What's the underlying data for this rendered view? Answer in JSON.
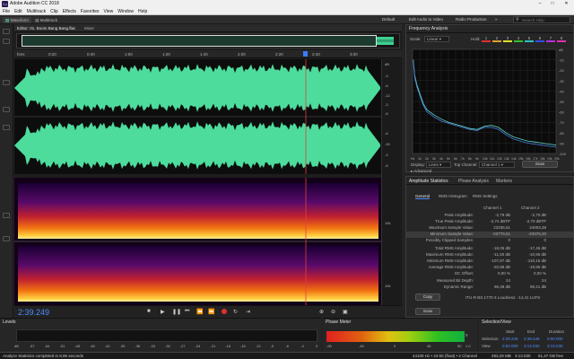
{
  "titlebar": {
    "title": "Adobe Audition CC 2018"
  },
  "menu": [
    "File",
    "Edit",
    "Multitrack",
    "Clip",
    "Effects",
    "Favorites",
    "View",
    "Window",
    "Help"
  ],
  "toolbar": {
    "waveform": "Waveform",
    "multitrack": "Multitrack",
    "ws_default": "Default",
    "ws_edit_video": "Edit Audio to Video",
    "ws_radio": "Radio Production",
    "search_placeholder": "Search Help"
  },
  "editor": {
    "tab_file": "Editor: 01. Boom Bang Bang.flac",
    "tab_mixer": "Mixer",
    "ruler_unit": "hms",
    "ruler_ticks": [
      "0:20",
      "0:40",
      "1:00",
      "1:20",
      "1:40",
      "2:00",
      "2:20",
      "2:40",
      "3:00"
    ],
    "db_labels_ch1": [
      "dB",
      "-3",
      "-6",
      "-12",
      "-3",
      "-6"
    ],
    "db_labels_ch2": [
      "-6",
      "-15",
      "-3",
      "-6"
    ],
    "hz_labels": [
      "10k",
      "10k"
    ],
    "timecode": "2:39.249"
  },
  "freq": {
    "title": "Frequency Analysis",
    "scale_label": "Scale:",
    "scale_value": "Linear",
    "hold_label": "Hold:",
    "hold_buttons": [
      "1",
      "2",
      "3",
      "4",
      "5",
      "6",
      "7",
      "8"
    ],
    "hold_colors": [
      "#e03030",
      "#e0a030",
      "#e0e030",
      "#30c030",
      "#30c0c0",
      "#3050e0",
      "#b030e0",
      "#e030b0"
    ],
    "db_ticks": [
      "dB",
      "-10",
      "-20",
      "-30",
      "-40",
      "-50",
      "-60",
      "-70",
      "-80",
      "-90",
      "-100"
    ],
    "hz_ticks": [
      "Hz",
      "1k",
      "2k",
      "3k",
      "4k",
      "5k",
      "6k",
      "7k",
      "8k",
      "9k",
      "10k",
      "11k",
      "12k",
      "13k",
      "14k",
      "15k",
      "16k",
      "17k",
      "18k",
      "19k",
      "20k"
    ],
    "display_label": "Display:",
    "display_value": "Lines",
    "top_channel_label": "Top Channel:",
    "top_channel_value": "Channel 1",
    "scan_label": "Scan",
    "advanced_label": "Advanced"
  },
  "amp": {
    "tabs": [
      "Amplitude Statistics",
      "Phase Analysis",
      "Markers"
    ],
    "subtabs": [
      "General",
      "RMS Histogram",
      "RMS Settings"
    ],
    "ch1_header": "Channel 1",
    "ch2_header": "Channel 2",
    "rows": [
      {
        "label": "Peak Amplitude:",
        "c1": "-2,79 dB",
        "c2": "-2,70 dB"
      },
      {
        "label": "True Peak Amplitude:",
        "c1": "-2,74 dBTP",
        "c2": "-2,70 dBTP"
      },
      {
        "label": "Maximum Sample Value:",
        "c1": "23336,61",
        "c2": "24003,38"
      },
      {
        "label": "Minimum Sample Value:",
        "c1": "-23779,61",
        "c2": "-23375,20"
      },
      {
        "label": "Possibly Clipped Samples:",
        "c1": "0",
        "c2": "0"
      },
      {
        "label": "Total RMS Amplitude:",
        "c1": "-18,06 dB",
        "c2": "-17,46 dB"
      },
      {
        "label": "Maximum RMS Amplitude:",
        "c1": "-11,50 dB",
        "c2": "-10,95 dB"
      },
      {
        "label": "Minimum RMS Amplitude:",
        "c1": "-107,87 dB",
        "c2": "-110,16 dB"
      },
      {
        "label": "Average RMS Amplitude:",
        "c1": "-20,98 dB",
        "c2": "-19,95 dB"
      },
      {
        "label": "DC Offset:",
        "c1": "0,00 %",
        "c2": "0,00 %"
      },
      {
        "label": "Measured Bit Depth:",
        "c1": "24",
        "c2": "24"
      },
      {
        "label": "Dynamic Range:",
        "c1": "96,38 dB",
        "c2": "99,21 dB"
      }
    ],
    "loudness": "ITU-R BS.1770-3 Loudness: -14,41 LUFS",
    "copy_label": "Copy",
    "scan_label": "Scan"
  },
  "levels": {
    "title": "Levels",
    "ticks": [
      "dB",
      "-57",
      "-54",
      "-51",
      "-48",
      "-45",
      "-42",
      "-39",
      "-36",
      "-33",
      "-30",
      "-27",
      "-24",
      "-21",
      "-18",
      "-15",
      "-12",
      "-9",
      "-6",
      "-3",
      "0"
    ]
  },
  "phase": {
    "title": "Phase Meter",
    "ticks": [
      "-90",
      "-45",
      "0",
      "45",
      "90"
    ],
    "left_value": "0",
    "right_value": "1.0"
  },
  "selview": {
    "title": "Selection/View",
    "col_start": "Start",
    "col_end": "End",
    "col_duration": "Duration",
    "rows": [
      {
        "label": "Selection",
        "start": "2:39.249",
        "end": "2:39.249",
        "duration": "0:00.000"
      },
      {
        "label": "View",
        "start": "0:00.000",
        "end": "3:13.030",
        "duration": "3:13.030"
      }
    ]
  },
  "status": {
    "message": "Analyze Statistics completed in 8,95 seconds",
    "format": "44100 Hz • 24-bit (float) • 2 Channel",
    "size": "293,29 MB",
    "duration": "3:13.030",
    "free": "51,47 GB free"
  },
  "chart_data": {
    "type": "line",
    "title": "Frequency Analysis",
    "xlabel": "Hz",
    "ylabel": "dB",
    "xlim": [
      0,
      20000
    ],
    "ylim": [
      -100,
      0
    ],
    "series": [
      {
        "name": "Channel 1",
        "color": "#5fd7c8",
        "x": [
          100,
          300,
          600,
          1000,
          1500,
          2000,
          3000,
          4000,
          5000,
          6000,
          7000,
          8000,
          9000,
          10000,
          11000,
          12000,
          13000,
          14000,
          15000,
          16000,
          17000,
          18000,
          19000,
          20000
        ],
        "values": [
          -10,
          -25,
          -34,
          -42,
          -52,
          -58,
          -63,
          -67,
          -70,
          -72,
          -74,
          -76,
          -77,
          -74,
          -73,
          -75,
          -80,
          -84,
          -86,
          -88,
          -89,
          -90,
          -91,
          -92
        ]
      },
      {
        "name": "Channel 2",
        "color": "#4a7fe0",
        "x": [
          100,
          300,
          600,
          1000,
          1500,
          2000,
          3000,
          4000,
          5000,
          6000,
          7000,
          8000,
          9000,
          10000,
          11000,
          12000,
          13000,
          14000,
          15000,
          16000,
          17000,
          18000,
          19000,
          20000
        ],
        "values": [
          -12,
          -27,
          -36,
          -44,
          -54,
          -60,
          -65,
          -69,
          -71,
          -73,
          -75,
          -77,
          -78,
          -75,
          -75,
          -77,
          -82,
          -86,
          -88,
          -90,
          -91,
          -92,
          -93,
          -94
        ]
      }
    ]
  }
}
